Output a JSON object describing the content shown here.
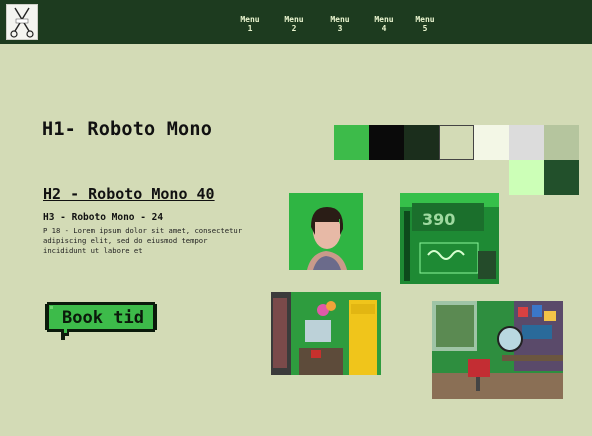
{
  "nav": {
    "logo_icon": "scissors-logo-icon",
    "menu": [
      {
        "line1": "Menu",
        "line2": "1"
      },
      {
        "line1": "Menu",
        "line2": "2"
      },
      {
        "line1": "Menu",
        "line2": "3"
      },
      {
        "line1": "Menu",
        "line2": "4"
      },
      {
        "line1": "Menu",
        "line2": "5"
      }
    ]
  },
  "typography": {
    "h1": "H1- Roboto Mono",
    "h2": "H2 - Roboto Mono 40",
    "h3": "H3 - Roboto Mono - 24",
    "p18": "P 18 - Lorem ipsum dolor sit amet, consectetur adipiscing elit, sed do eiusmod tempor incididunt ut labore et"
  },
  "palette": [
    "#3dbb4a",
    "#0a0a0a",
    "#1b2e1c",
    "#d3dbb6",
    "#f3f7e6",
    "#dcdcdc",
    "#b5c59e",
    "#ccffb7",
    "#22502b"
  ],
  "button": {
    "label": "Book tid"
  },
  "photos": [
    {
      "name": "portrait-photo",
      "icon": "person-portrait-icon"
    },
    {
      "name": "neon-sign-photo",
      "icon": "neon-sign-icon"
    },
    {
      "name": "salon-interior-photo",
      "icon": "salon-room-icon"
    },
    {
      "name": "barber-chair-photo",
      "icon": "barber-chair-icon"
    }
  ],
  "colors": {
    "nav_bg": "#1d3b1f",
    "page_bg": "#d3dbb6",
    "accent_green": "#3dbb4a"
  }
}
